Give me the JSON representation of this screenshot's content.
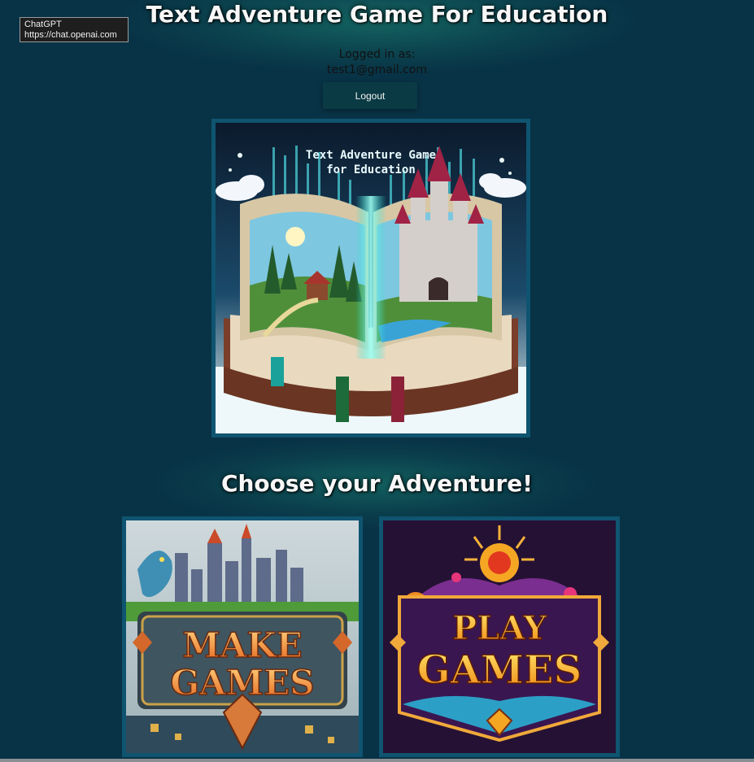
{
  "tooltip": {
    "line1": "ChatGPT",
    "line2": "https://chat.openai.com"
  },
  "header": {
    "title": "Text Adventure Game For Education"
  },
  "user": {
    "logged_in_label": "Logged in as:",
    "email": "test1@gmail.com"
  },
  "actions": {
    "logout_label": "Logout"
  },
  "hero": {
    "banner_line1": "Text Adventure Game",
    "banner_line2": "for Education"
  },
  "section": {
    "title": "Choose your Adventure!"
  },
  "cards": [
    {
      "line1": "MAKE",
      "line2": "GAMES"
    },
    {
      "line1": "PLAY",
      "line2": "GAMES"
    }
  ],
  "colors": {
    "background": "#083346",
    "frame": "#0f5470",
    "button": "#0a3a44"
  }
}
